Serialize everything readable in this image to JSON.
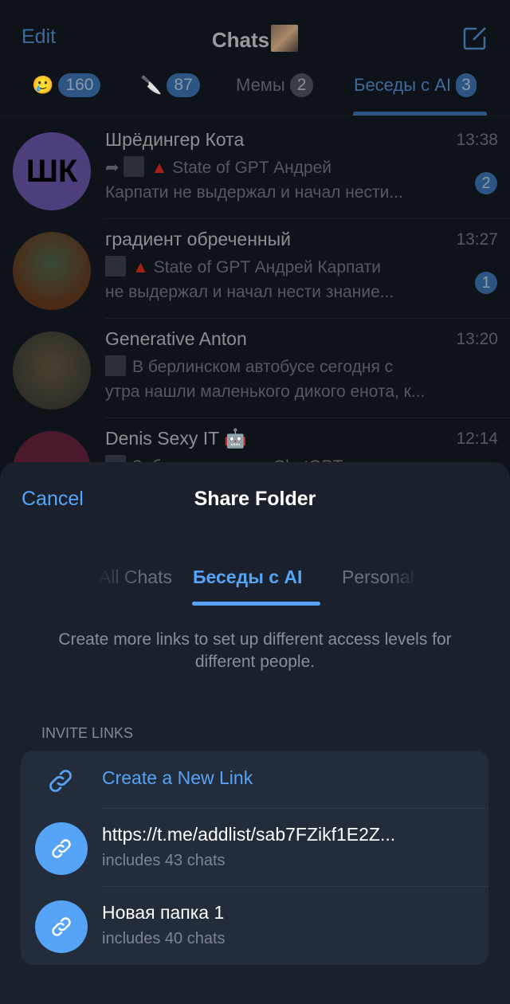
{
  "header": {
    "edit": "Edit",
    "title": "Chats",
    "compose_icon": "compose-icon"
  },
  "folder_tabs": [
    {
      "emoji": "🥲",
      "badge": "160"
    },
    {
      "emoji": "🔪",
      "badge": "87"
    },
    {
      "label": "Мемы",
      "badge": "2"
    },
    {
      "label": "Беседы с AI",
      "badge": "3",
      "active": true
    }
  ],
  "chats": [
    {
      "name": "Шрёдингер Кота",
      "time": "13:38",
      "preview1": "State of GPT Андрей",
      "preview2": "Карпати не выдержал и начал нести...",
      "unread": "2",
      "avatar_text": "ШК"
    },
    {
      "name": "градиент обреченный",
      "time": "13:27",
      "preview1": "State of GPT Андрей Карпати",
      "preview2": "не выдержал и начал нести знание...",
      "unread": "1"
    },
    {
      "name": "Generative Anton",
      "time": "13:20",
      "preview1": "В берлинском автобусе сегодня с",
      "preview2": "утра нашли маленького дикого енота, к..."
    },
    {
      "name": "Denis Sexy IT 🤖",
      "time": "12:14",
      "preview1": "Забавная игра на ChatGPT — умника"
    }
  ],
  "sheet": {
    "cancel": "Cancel",
    "title": "Share Folder",
    "tabs": [
      "All Chats",
      "Беседы с AI",
      "Personal"
    ],
    "active_tab": "Беседы с AI",
    "description": "Create more links to set up different access levels for different people.",
    "section_header": "INVITE LINKS",
    "create_link": "Create a New Link",
    "links": [
      {
        "title": "https://t.me/addlist/sab7FZikf1E2Z...",
        "subtitle": "includes 43 chats"
      },
      {
        "title": "Новая папка 1",
        "subtitle": "includes 40 chats"
      }
    ]
  },
  "colors": {
    "accent": "#55a4f8",
    "sheet_bg": "#1b212c",
    "card_bg": "#232c3a"
  }
}
